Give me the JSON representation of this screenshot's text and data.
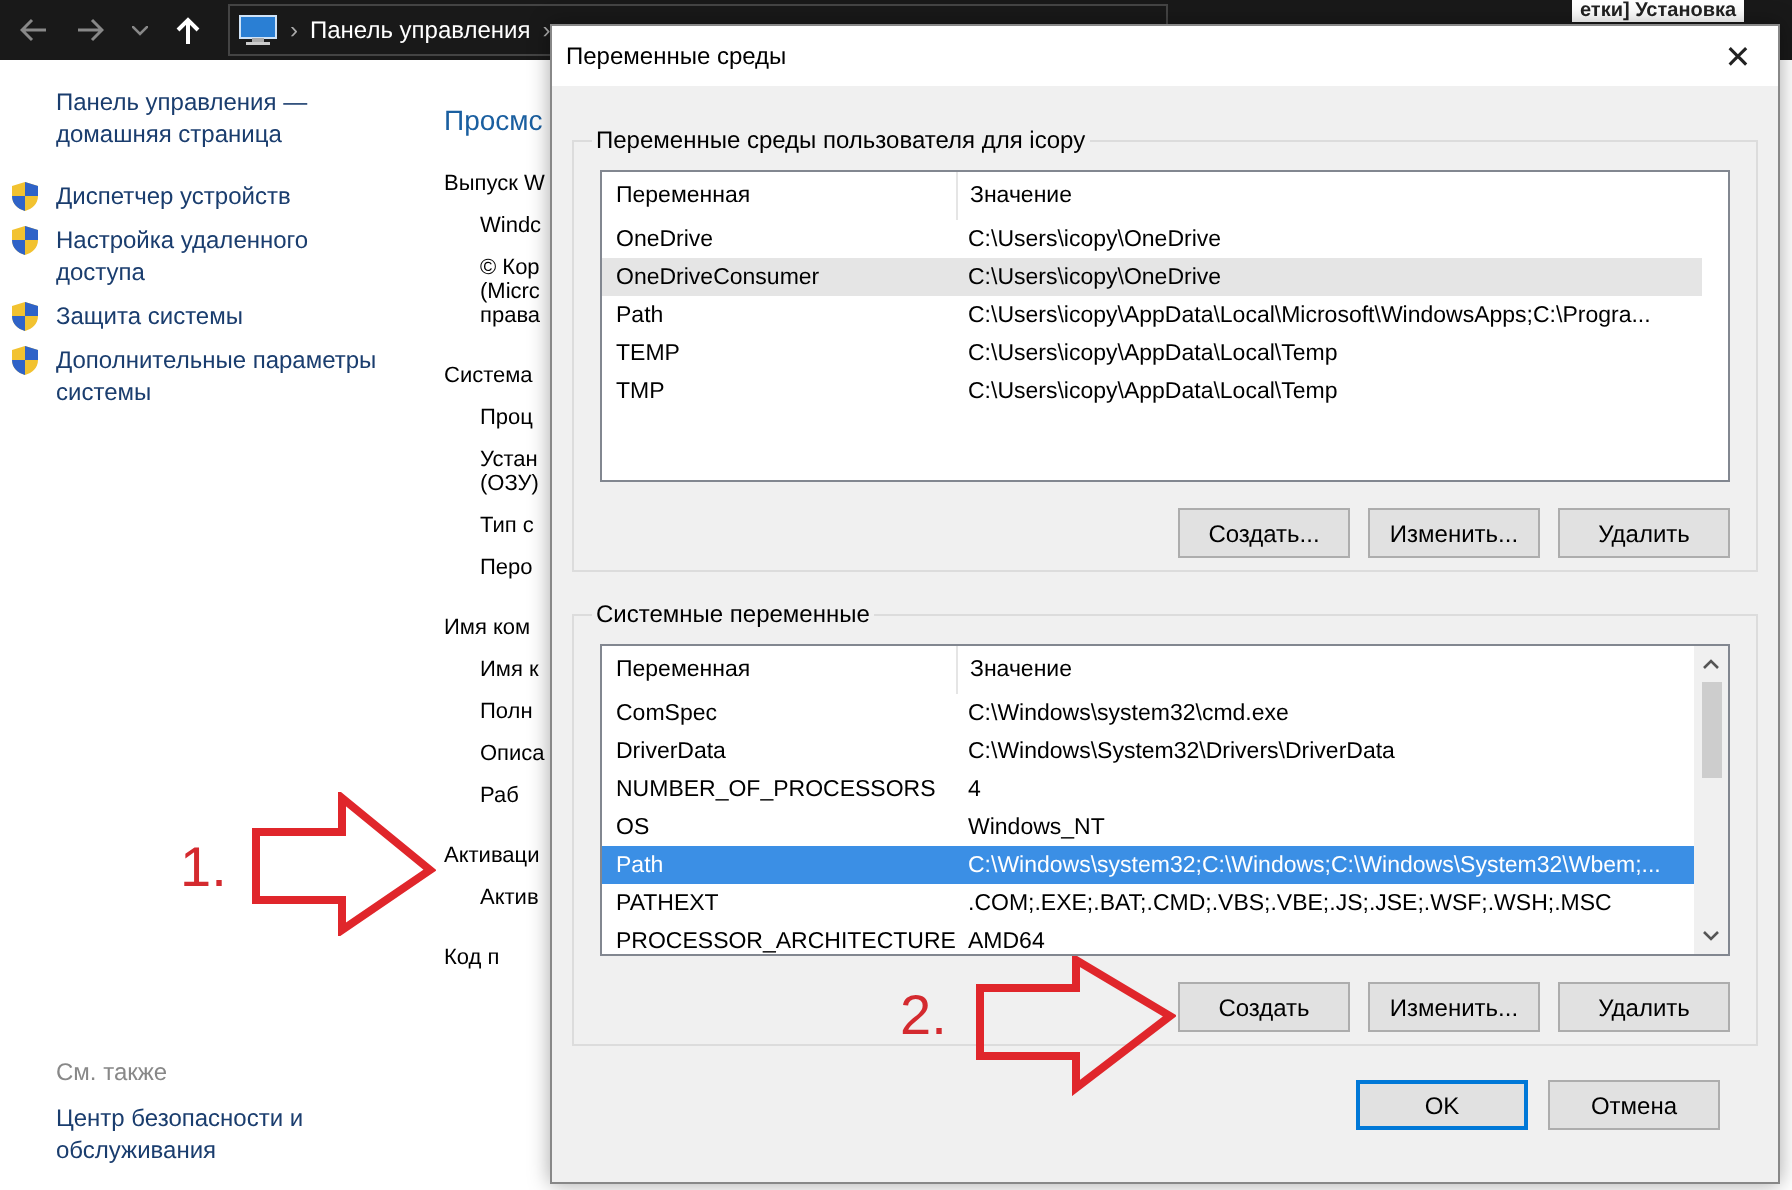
{
  "explorer": {
    "address": "Панель управления",
    "separators": [
      "›",
      "›"
    ],
    "right_title": "етки] Установка",
    "sidebar": {
      "home": [
        "Панель управления —",
        "домашняя страница"
      ],
      "links": [
        {
          "label": "Диспетчер устройств"
        },
        {
          "label": "Настройка удаленного доступа"
        },
        {
          "label": "Защита системы"
        },
        {
          "label": "Дополнительные параметры системы"
        }
      ],
      "see_also": "См. также",
      "see_also_links": [
        {
          "label": "Центр безопасности и обслуживания"
        }
      ]
    },
    "main": [
      {
        "kind": "heading",
        "text": "Просмс"
      },
      {
        "kind": "section",
        "text": "Выпуск W"
      },
      {
        "kind": "line",
        "text": "Windc"
      },
      {
        "kind": "line",
        "text": "© Кор"
      },
      {
        "kind": "wrap",
        "text": "(Micrс"
      },
      {
        "kind": "wrap",
        "text": "права"
      },
      {
        "kind": "section",
        "text": "Система"
      },
      {
        "kind": "line",
        "text": "Проц"
      },
      {
        "kind": "line",
        "text": "Устан"
      },
      {
        "kind": "wrap",
        "text": "(ОЗУ)"
      },
      {
        "kind": "line",
        "text": "Тип с"
      },
      {
        "kind": "line",
        "text": "Перо"
      },
      {
        "kind": "section",
        "text": "Имя ком"
      },
      {
        "kind": "line",
        "text": "Имя к"
      },
      {
        "kind": "line",
        "text": "Полн"
      },
      {
        "kind": "line",
        "text": "Описа"
      },
      {
        "kind": "line",
        "text": "Раб"
      },
      {
        "kind": "section",
        "text": "Активаци"
      },
      {
        "kind": "line",
        "text": "Актив"
      },
      {
        "kind": "section",
        "text": "Код п"
      }
    ]
  },
  "dialog": {
    "title": "Переменные среды",
    "close": "✕",
    "user_vars": {
      "label": "Переменные среды пользователя для icopy",
      "columns": [
        "Переменная",
        "Значение"
      ],
      "rows": [
        {
          "name": "OneDrive",
          "value": "C:\\Users\\icopy\\OneDrive",
          "hovered": false
        },
        {
          "name": "OneDriveConsumer",
          "value": "C:\\Users\\icopy\\OneDrive",
          "hovered": true
        },
        {
          "name": "Path",
          "value": "C:\\Users\\icopy\\AppData\\Local\\Microsoft\\WindowsApps;C:\\Progra...",
          "hovered": false
        },
        {
          "name": "TEMP",
          "value": "C:\\Users\\icopy\\AppData\\Local\\Temp",
          "hovered": false
        },
        {
          "name": "TMP",
          "value": "C:\\Users\\icopy\\AppData\\Local\\Temp",
          "hovered": false
        }
      ],
      "buttons": [
        "Создать...",
        "Изменить...",
        "Удалить"
      ]
    },
    "system_vars": {
      "label": "Системные переменные",
      "columns": [
        "Переменная",
        "Значение"
      ],
      "rows": [
        {
          "name": "ComSpec",
          "value": "C:\\Windows\\system32\\cmd.exe",
          "selected": false
        },
        {
          "name": "DriverData",
          "value": "C:\\Windows\\System32\\Drivers\\DriverData",
          "selected": false
        },
        {
          "name": "NUMBER_OF_PROCESSORS",
          "value": "4",
          "selected": false
        },
        {
          "name": "OS",
          "value": "Windows_NT",
          "selected": false
        },
        {
          "name": "Path",
          "value": "C:\\Windows\\system32;C:\\Windows;C:\\Windows\\System32\\Wbem;...",
          "selected": true
        },
        {
          "name": "PATHEXT",
          "value": ".COM;.EXE;.BAT;.CMD;.VBS;.VBE;.JS;.JSE;.WSF;.WSH;.MSC",
          "selected": false
        },
        {
          "name": "PROCESSOR_ARCHITECTURE",
          "value": "AMD64",
          "selected": false
        }
      ],
      "buttons": [
        "Создать",
        "Изменить...",
        "Удалить"
      ]
    },
    "ok": "OK",
    "cancel": "Отмена"
  },
  "annotations": [
    {
      "label": "1."
    },
    {
      "label": "2."
    }
  ]
}
